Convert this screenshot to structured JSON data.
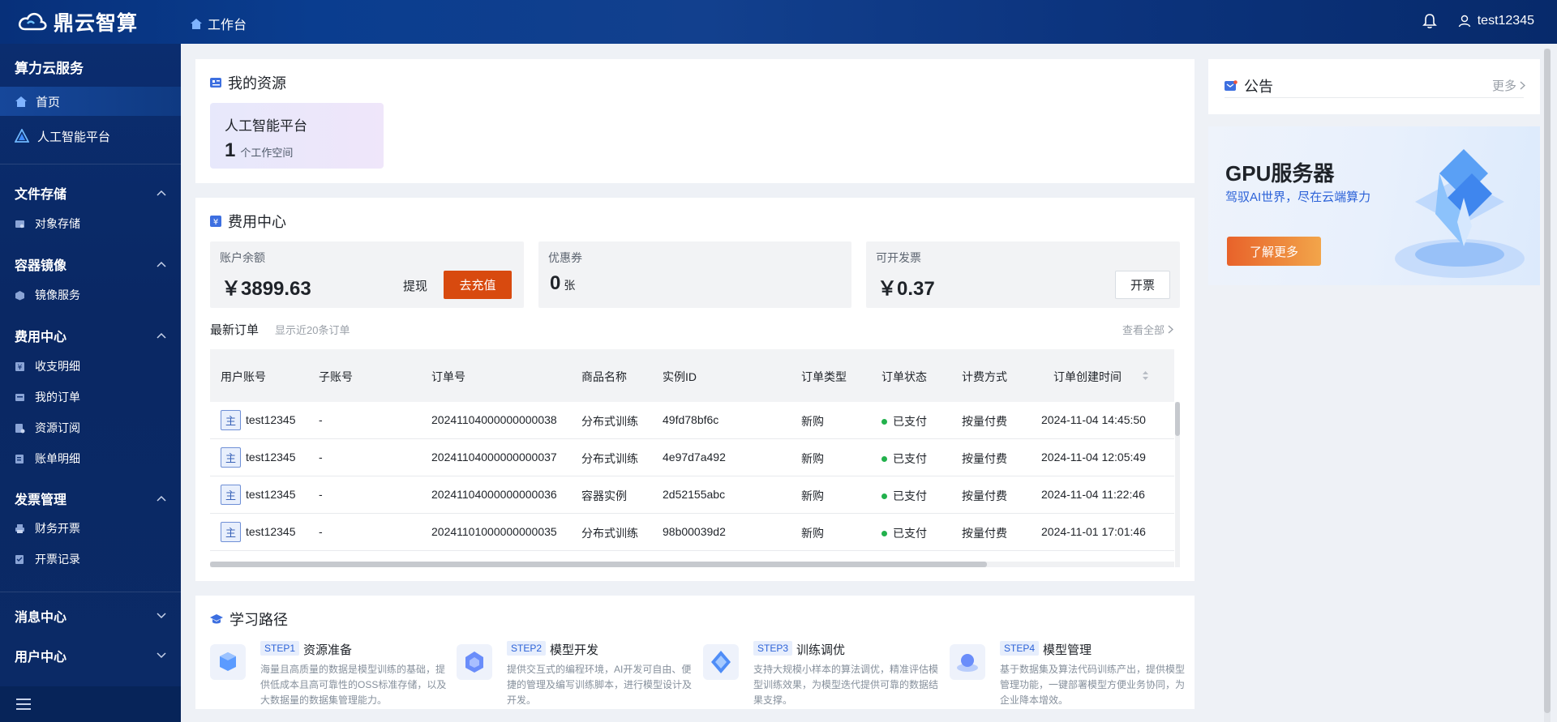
{
  "app": {
    "logo_text": "鼎云智算"
  },
  "header": {
    "breadcrumb": "工作台",
    "username": "test12345"
  },
  "sidebar": {
    "section_title": "算力云服务",
    "items_top": [
      {
        "label": "首页",
        "icon": "home-icon",
        "active": true
      },
      {
        "label": "人工智能平台",
        "icon": "ai-platform-icon",
        "active": false
      }
    ],
    "categories": [
      {
        "label": "文件存储",
        "items": [
          "对象存储"
        ]
      },
      {
        "label": "容器镜像",
        "items": [
          "镜像服务"
        ]
      },
      {
        "label": "费用中心",
        "items": [
          "收支明细",
          "我的订单",
          "资源订阅",
          "账单明细"
        ]
      },
      {
        "label": "发票管理",
        "items": [
          "财务开票",
          "开票记录"
        ]
      },
      {
        "label": "消息中心",
        "items": []
      },
      {
        "label": "用户中心",
        "items": []
      }
    ]
  },
  "resources": {
    "title": "我的资源",
    "tile_name": "人工智能平台",
    "tile_count": "1",
    "tile_unit": "个工作空间"
  },
  "fees": {
    "title": "费用中心",
    "balance_label": "账户余额",
    "balance_value": "￥3899.63",
    "withdraw_label": "提现",
    "recharge_label": "去充值",
    "coupon_label": "优惠券",
    "coupon_value": "0",
    "coupon_unit": "张",
    "invoice_label": "可开发票",
    "invoice_value": "￥0.37",
    "invoice_button": "开票"
  },
  "orders": {
    "title": "最新订单",
    "hint": "显示近20条订单",
    "view_all": "查看全部",
    "columns": [
      "用户账号",
      "子账号",
      "订单号",
      "商品名称",
      "实例ID",
      "订单类型",
      "订单状态",
      "计费方式",
      "订单创建时间"
    ],
    "tag": "主",
    "rows": [
      {
        "user": "test12345",
        "sub": "-",
        "order_no": "20241104000000000038",
        "product": "分布式训练",
        "instance": "49fd78bf6c",
        "type": "新购",
        "status": "已支付",
        "billing": "按量付费",
        "created": "2024-11-04 14:45:50"
      },
      {
        "user": "test12345",
        "sub": "-",
        "order_no": "20241104000000000037",
        "product": "分布式训练",
        "instance": "4e97d7a492",
        "type": "新购",
        "status": "已支付",
        "billing": "按量付费",
        "created": "2024-11-04 12:05:49"
      },
      {
        "user": "test12345",
        "sub": "-",
        "order_no": "20241104000000000036",
        "product": "容器实例",
        "instance": "2d52155abc",
        "type": "新购",
        "status": "已支付",
        "billing": "按量付费",
        "created": "2024-11-04 11:22:46"
      },
      {
        "user": "test12345",
        "sub": "-",
        "order_no": "20241101000000000035",
        "product": "分布式训练",
        "instance": "98b00039d2",
        "type": "新购",
        "status": "已支付",
        "billing": "按量付费",
        "created": "2024-11-01 17:01:46"
      }
    ]
  },
  "learning": {
    "title": "学习路径",
    "steps": [
      {
        "badge": "STEP1",
        "name": "资源准备",
        "desc": "海量且高质量的数据是模型训练的基础，提供低成本且高可靠性的OSS标准存储，以及大数据量的数据集管理能力。"
      },
      {
        "badge": "STEP2",
        "name": "模型开发",
        "desc": "提供交互式的编程环境，AI开发可自由、便捷的管理及编写训练脚本，进行模型设计及开发。"
      },
      {
        "badge": "STEP3",
        "name": "训练调优",
        "desc": "支持大规模小样本的算法调优，精准评估模型训练效果，为模型迭代提供可靠的数据结果支撑。"
      },
      {
        "badge": "STEP4",
        "name": "模型管理",
        "desc": "基于数据集及算法代码训练产出，提供模型管理功能，一键部署模型方便业务协同，为企业降本增效。"
      }
    ]
  },
  "notice": {
    "title": "公告",
    "more": "更多",
    "banner_title": "GPU服务器",
    "banner_sub": "驾驭AI世界，尽在云端算力",
    "banner_button": "了解更多"
  },
  "colors": {
    "accent": "#2c62d8",
    "recharge": "#d84a0f",
    "paid": "#22b14c",
    "sidebar": "#0b2d6f"
  }
}
